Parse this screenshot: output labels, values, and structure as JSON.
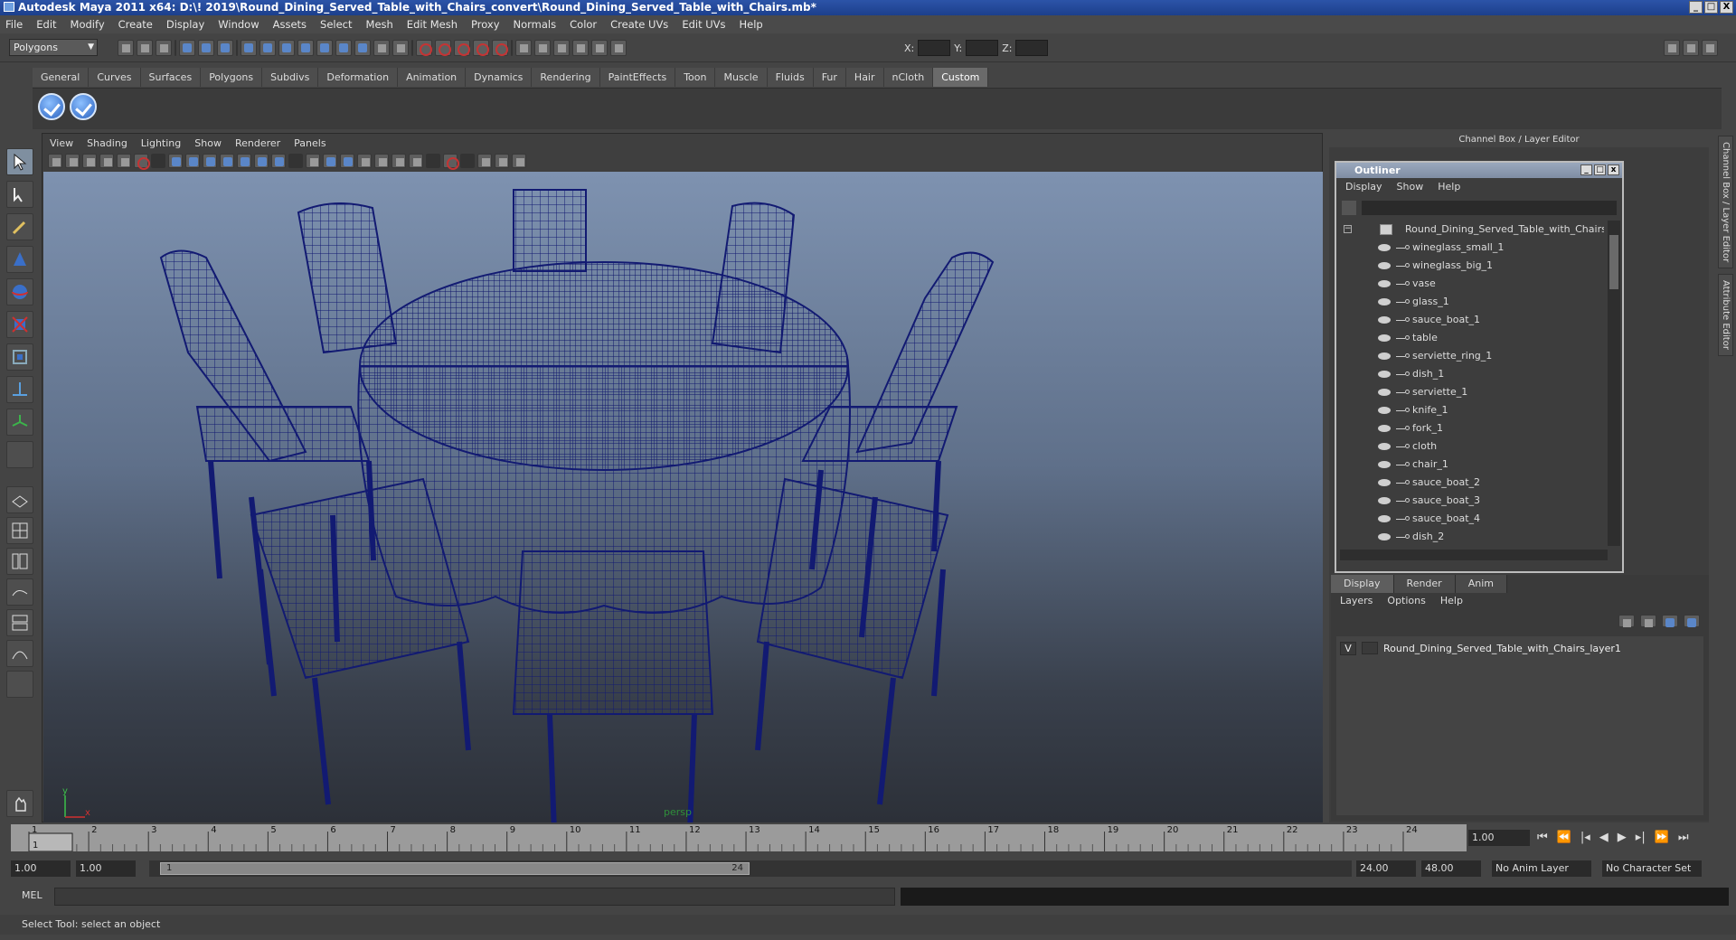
{
  "window": {
    "title": "Autodesk Maya 2011 x64: D:\\! 2019\\Round_Dining_Served_Table_with_Chairs_convert\\Round_Dining_Served_Table_with_Chairs.mb*",
    "min": "_",
    "max": "□",
    "close": "X"
  },
  "menubar": [
    "File",
    "Edit",
    "Modify",
    "Create",
    "Display",
    "Window",
    "Assets",
    "Select",
    "Mesh",
    "Edit Mesh",
    "Proxy",
    "Normals",
    "Color",
    "Create UVs",
    "Edit UVs",
    "Help"
  ],
  "status": {
    "mode": "Polygons",
    "x_label": "X:",
    "y_label": "Y:",
    "z_label": "Z:"
  },
  "shelf": {
    "tabs": [
      "General",
      "Curves",
      "Surfaces",
      "Polygons",
      "Subdivs",
      "Deformation",
      "Animation",
      "Dynamics",
      "Rendering",
      "PaintEffects",
      "Toon",
      "Muscle",
      "Fluids",
      "Fur",
      "Hair",
      "nCloth",
      "Custom"
    ],
    "active": "Custom"
  },
  "viewport": {
    "menu": [
      "View",
      "Shading",
      "Lighting",
      "Show",
      "Renderer",
      "Panels"
    ],
    "camera_label": "persp",
    "axis_x": "x",
    "axis_y": "y",
    "wire_color": "#121a72"
  },
  "right_panel": {
    "header": "Channel Box / Layer Editor",
    "side_tabs": [
      "Channel Box / Layer Editor",
      "Attribute Editor"
    ]
  },
  "outliner": {
    "title": "Outliner",
    "menu": [
      "Display",
      "Show",
      "Help"
    ],
    "root": "Round_Dining_Served_Table_with_Chairs",
    "items": [
      "wineglass_small_1",
      "wineglass_big_1",
      "vase",
      "glass_1",
      "sauce_boat_1",
      "table",
      "serviette_ring_1",
      "dish_1",
      "serviette_1",
      "knife_1",
      "fork_1",
      "cloth",
      "chair_1",
      "sauce_boat_2",
      "sauce_boat_3",
      "sauce_boat_4",
      "dish_2"
    ]
  },
  "layers": {
    "tabs": [
      "Display",
      "Render",
      "Anim"
    ],
    "active_tab": "Display",
    "menu": [
      "Layers",
      "Options",
      "Help"
    ],
    "rows": [
      {
        "visible": "V",
        "name": "Round_Dining_Served_Table_with_Chairs_layer1"
      }
    ]
  },
  "timeline": {
    "ticks": [
      "1",
      "2",
      "3",
      "4",
      "5",
      "6",
      "7",
      "8",
      "9",
      "10",
      "11",
      "12",
      "13",
      "14",
      "15",
      "16",
      "17",
      "18",
      "19",
      "20",
      "21",
      "22",
      "23",
      "24"
    ],
    "current_marker": "1",
    "current_frame": "1.00"
  },
  "range": {
    "start": "1.00",
    "playback_start": "1.00",
    "thumb_start": "1",
    "thumb_end": "24",
    "playback_end": "24.00",
    "end": "48.00",
    "anim_layer": "No Anim Layer",
    "character_set": "No Character Set"
  },
  "mel": {
    "label": "MEL"
  },
  "help_line": "Select Tool: select an object"
}
